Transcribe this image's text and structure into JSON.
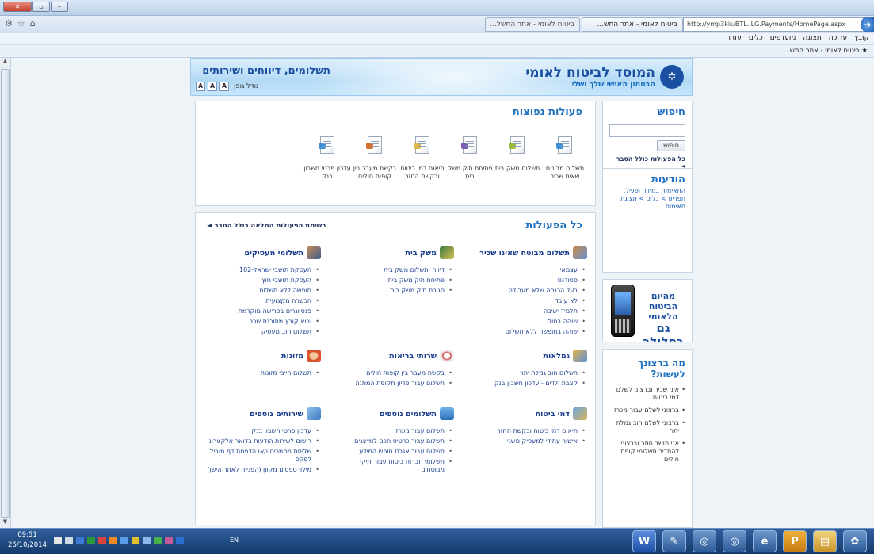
{
  "browser": {
    "tabs": [
      "ביטוח לאומי - אתר התשל...",
      "ביטוח לאומי - אתר התש..."
    ],
    "address": "http://ymp3kis/BTL.ILG.Payments/HomePage.aspx",
    "menu": [
      "קובץ",
      "עריכה",
      "תצוגה",
      "מועדפים",
      "כלים",
      "עזרה"
    ],
    "favorite": "ביטוח לאומי - אתר התש..."
  },
  "banner": {
    "logo_title": "המוסד לביטוח לאומי",
    "logo_sub": "הבטחון האישי שלך ושלי",
    "section_title": "תשלומים, דיווחים ושירותים",
    "font_label": "גודל גופן",
    "font_btn": "A"
  },
  "search": {
    "title": "חיפוש",
    "button": "חיפוש",
    "link": "כל הפעולות כולל הסבר ◄"
  },
  "news": {
    "title": "הודעות",
    "items": [
      "התאימות במידה ופעיל.",
      "תפריט > כלים > תצוגת תאימות"
    ]
  },
  "mobile": {
    "line1": "מהיום",
    "line2": "הביטוח הלאומי",
    "line3": "גם בסלולר"
  },
  "whatdo": {
    "title": "מה ברצונך לעשות?",
    "items": [
      "איני שכיר וברצוני לשלם דמי ביטוח",
      "ברצוני לשלם עבור מכרז",
      "ברצוני לשלם חוב גמלת יתר",
      "אני תושב חוזר וברצוני להסדיר תשלומי קופת חולים"
    ]
  },
  "popular": {
    "title": "פעולות נפוצות",
    "items": [
      {
        "label": "תשלום מבוטח שאינו שכיר",
        "icon": "document-icon"
      },
      {
        "label": "תשלום משק בית",
        "icon": "document-sun-icon"
      },
      {
        "label": "פתיחת תיק משק בית",
        "icon": "document-calc-icon"
      },
      {
        "label": "תיאום דמי ביטוח ובקשת החזר",
        "icon": "document-note-icon"
      },
      {
        "label": "בקשת מעבר בין קופות חולים",
        "icon": "document-pen-icon"
      },
      {
        "label": "עדכון פרטי חשבון בנק",
        "icon": "document-edit-icon"
      }
    ]
  },
  "all": {
    "title": "כל הפעולות",
    "full_list": "רשימת הפעולות המלאה כולל הסבר ◄",
    "cats": {
      "selfemp": {
        "title": "תשלום מבוטח שאינו שכיר",
        "items": [
          "עצמאי",
          "סטודנט",
          "בעל הכנסה שלא מעבודה",
          "לא עובד",
          "תלמיד ישיבה",
          "שוהה בחול",
          "שוהה בחופשה ללא תשלום"
        ]
      },
      "household": {
        "title": "משק בית",
        "items": [
          "דיווח ותשלום משק בית",
          "פתיחת תיק משק בית",
          "סגירת תיק משק בית"
        ]
      },
      "employers": {
        "title": "תשלומי מעסיקים",
        "items": [
          "העסקת תושבי ישראל-102",
          "העסקת תושבי חוץ",
          "חופשה ללא תשלום",
          "הכשרה מקצועית",
          "פנסיונרים בפרישה מוקדמת",
          "יבוא קובץ מתוכנת שכר",
          "תשלום חוב מעסיק"
        ]
      },
      "benefits": {
        "title": "גמלאות",
        "items": [
          "תשלום חוב גמלת יתר",
          "קצבת ילדים - עדכון חשבון בנק"
        ]
      },
      "health": {
        "title": "שרותי בריאות",
        "items": [
          "בקשת מעבר בין קופות חולים",
          "תשלום עבור פדיון תקופת המתנה"
        ]
      },
      "alimony": {
        "title": "מזונות",
        "items": [
          "תשלום חייבי מזונות"
        ]
      },
      "insurance": {
        "title": "דמי ביטוח",
        "items": [
          "תיאום דמי ביטוח ובקשת החזר",
          "אישור עתידי למעסיק משני"
        ]
      },
      "morepay": {
        "title": "תשלומים נוספים",
        "items": [
          "תשלום עבור מכרז",
          "תשלום עבור כרטיס חכם למייצגים",
          "תשלום עבור אגרת חופש המידע",
          "תשלומי חברות ביטוח עבור תיקי מבוטחים"
        ]
      },
      "moreserv": {
        "title": "שירותים נוספים",
        "items": [
          "עדכון פרטי חשבון בנק",
          "רישום לשירות הודעות בדואר אלקטרוני",
          "שליחת מסמכים ו/או הדפסת דף מוביל לפקס",
          "מילוי טפסים מקוון (הפנייה לאתר הישן)"
        ]
      }
    }
  },
  "taskbar": {
    "time": "09:51",
    "date": "26/10/2014",
    "lang": "EN"
  },
  "colors": {
    "accent": "#1d6fbf",
    "brand": "#1b4fa1",
    "taskbar": "#1e4a82"
  }
}
